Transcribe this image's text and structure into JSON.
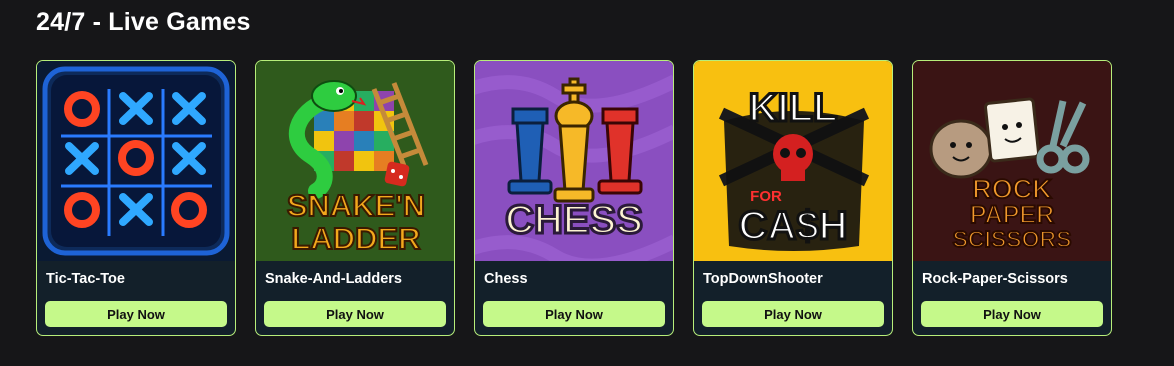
{
  "section": {
    "title": "24/7 - Live Games"
  },
  "cards": [
    {
      "title": "Tic-Tac-Toe",
      "button": "Play Now",
      "icon": "tic-tac-toe-logo"
    },
    {
      "title": "Snake-And-Ladders",
      "button": "Play Now",
      "icon": "snake-ladder-logo",
      "art_text": [
        "SNAKE'N",
        "LADDER"
      ]
    },
    {
      "title": "Chess",
      "button": "Play Now",
      "icon": "chess-logo",
      "art_text": [
        "CHESS"
      ]
    },
    {
      "title": "TopDownShooter",
      "button": "Play Now",
      "icon": "kill-for-cash-logo",
      "art_text": [
        "KILL",
        "FOR",
        "CA$H"
      ]
    },
    {
      "title": "Rock-Paper-Scissors",
      "button": "Play Now",
      "icon": "rock-paper-scissors-logo",
      "art_text": [
        "ROCK",
        "PAPER",
        "SCISSORS"
      ]
    }
  ],
  "colors": {
    "background": "#161618",
    "card_border": "#b7ee7a",
    "button_bg": "#c5f98a",
    "card_bg": "#13202a"
  }
}
